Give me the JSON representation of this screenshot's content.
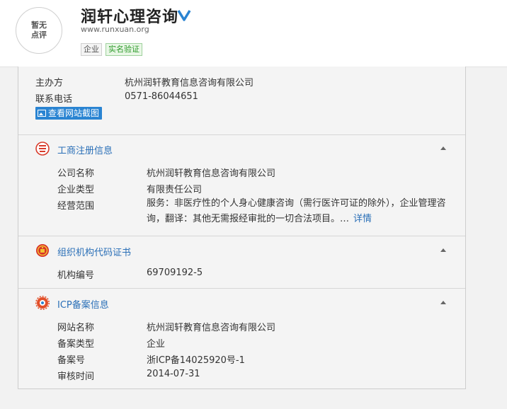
{
  "header": {
    "score_line1": "暂无",
    "score_line2": "点评",
    "title": "润轩心理咨询",
    "domain": "www.runxuan.org",
    "tags": [
      "企业",
      "实名验证"
    ]
  },
  "basic": {
    "sponsor_label": "主办方",
    "sponsor_value": "杭州润轩教育信息咨询有限公司",
    "phone_label": "联系电话",
    "phone_value": "0571-86044651",
    "screenshot_button": "查看网站截图"
  },
  "business": {
    "title": "工商注册信息",
    "company_label": "公司名称",
    "company_value": "杭州润轩教育信息咨询有限公司",
    "type_label": "企业类型",
    "type_value": "有限责任公司",
    "scope_label": "经营范围",
    "scope_value": "服务：非医疗性的个人身心健康咨询（需行医许可证的除外），企业管理咨询，翻译：其他无需报经审批的一切合法项目。…",
    "more_link": "详情"
  },
  "org_code": {
    "title": "组织机构代码证书",
    "code_label": "机构编号",
    "code_value": "69709192-5"
  },
  "icp": {
    "title": "ICP备案信息",
    "site_name_label": "网站名称",
    "site_name_value": "杭州润轩教育信息咨询有限公司",
    "record_type_label": "备案类型",
    "record_type_value": "企业",
    "record_no_label": "备案号",
    "record_no_value": "浙ICP备14025920号-1",
    "review_date_label": "审核时间",
    "review_date_value": "2014-07-31"
  },
  "colors": {
    "link_blue": "#2a6fb7",
    "button_blue": "#2a84d2",
    "verified_green": "#2c9a2a"
  },
  "icons": {
    "verified": "check-v-icon",
    "business": "red-seal-icon",
    "org": "national-emblem-icon",
    "icp": "gear-icon",
    "collapse": "triangle-up-icon"
  }
}
